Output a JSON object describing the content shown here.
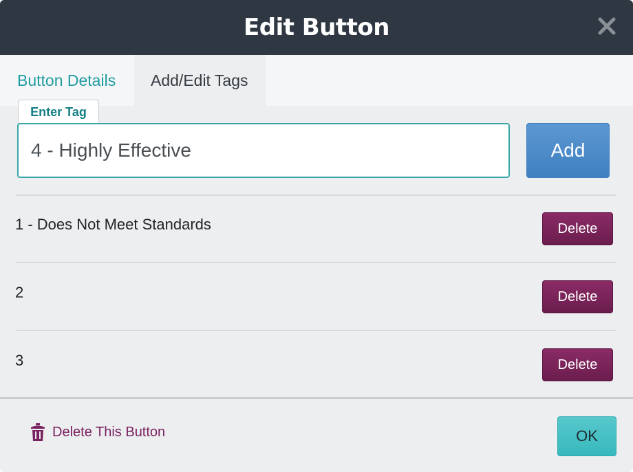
{
  "header": {
    "title": "Edit Button",
    "close_icon": "close-icon"
  },
  "tabs": [
    {
      "label": "Button Details",
      "active": false
    },
    {
      "label": "Add/Edit Tags",
      "active": true
    }
  ],
  "tag_entry": {
    "label": "Enter Tag",
    "value": "4 - Highly Effective",
    "add_label": "Add"
  },
  "tags": [
    {
      "text": "1 - Does Not Meet Standards",
      "delete_label": "Delete"
    },
    {
      "text": "2",
      "delete_label": "Delete"
    },
    {
      "text": "3",
      "delete_label": "Delete"
    }
  ],
  "footer": {
    "delete_button_label": "Delete This Button",
    "delete_icon": "trash-icon",
    "ok_label": "OK"
  },
  "colors": {
    "header_bg": "#2f3842",
    "accent_teal": "#1e9ba0",
    "add_blue": "#4a8ac9",
    "delete_purple": "#7a2160",
    "ok_teal": "#45c0c4"
  }
}
